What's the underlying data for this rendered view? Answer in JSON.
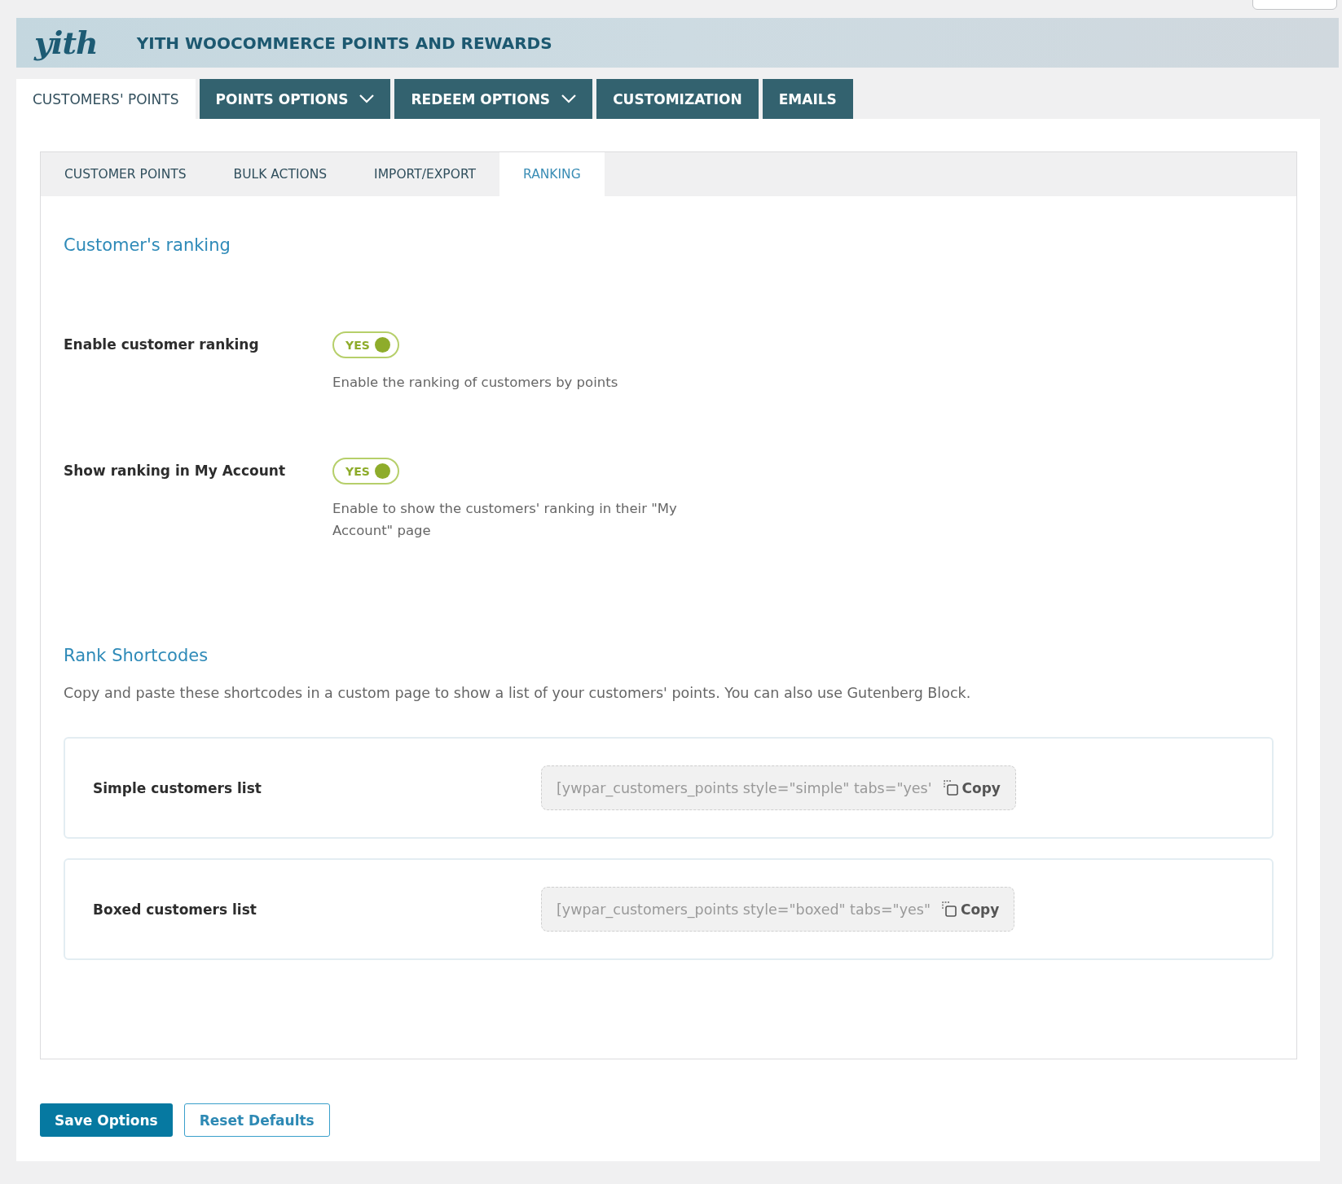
{
  "header": {
    "logo": "yith",
    "title": "YITH WOOCOMMERCE POINTS AND REWARDS"
  },
  "main_tabs": [
    {
      "label": "CUSTOMERS' POINTS",
      "kind": "plain",
      "selected": true
    },
    {
      "label": "POINTS OPTIONS",
      "kind": "dropdown",
      "selected": false
    },
    {
      "label": "REDEEM OPTIONS",
      "kind": "dropdown",
      "selected": false
    },
    {
      "label": "CUSTOMIZATION",
      "kind": "plain",
      "selected": false
    },
    {
      "label": "EMAILS",
      "kind": "plain",
      "selected": false
    }
  ],
  "sub_tabs": [
    {
      "label": "CUSTOMER POINTS",
      "selected": false
    },
    {
      "label": "BULK ACTIONS",
      "selected": false
    },
    {
      "label": "IMPORT/EXPORT",
      "selected": false
    },
    {
      "label": "RANKING",
      "selected": true
    }
  ],
  "ranking": {
    "heading": "Customer's ranking",
    "settings": [
      {
        "label": "Enable customer ranking",
        "toggle_label": "YES",
        "on": true,
        "description": "Enable the ranking of customers by points"
      },
      {
        "label": "Show ranking in My Account",
        "toggle_label": "YES",
        "on": true,
        "description": "Enable to show the customers' ranking in their \"My Account\" page"
      }
    ]
  },
  "shortcodes": {
    "heading": "Rank Shortcodes",
    "description": "Copy and paste these shortcodes in a custom page to show a list of your customers' points. You can also use Gutenberg Block.",
    "items": [
      {
        "label": "Simple customers list",
        "code": "[ywpar_customers_points style=\"simple\" tabs=\"yes'",
        "copy": "Copy"
      },
      {
        "label": "Boxed customers list",
        "code": "[ywpar_customers_points style=\"boxed\" tabs=\"yes\"",
        "copy": "Copy"
      }
    ]
  },
  "buttons": {
    "save": "Save Options",
    "reset": "Reset Defaults"
  }
}
